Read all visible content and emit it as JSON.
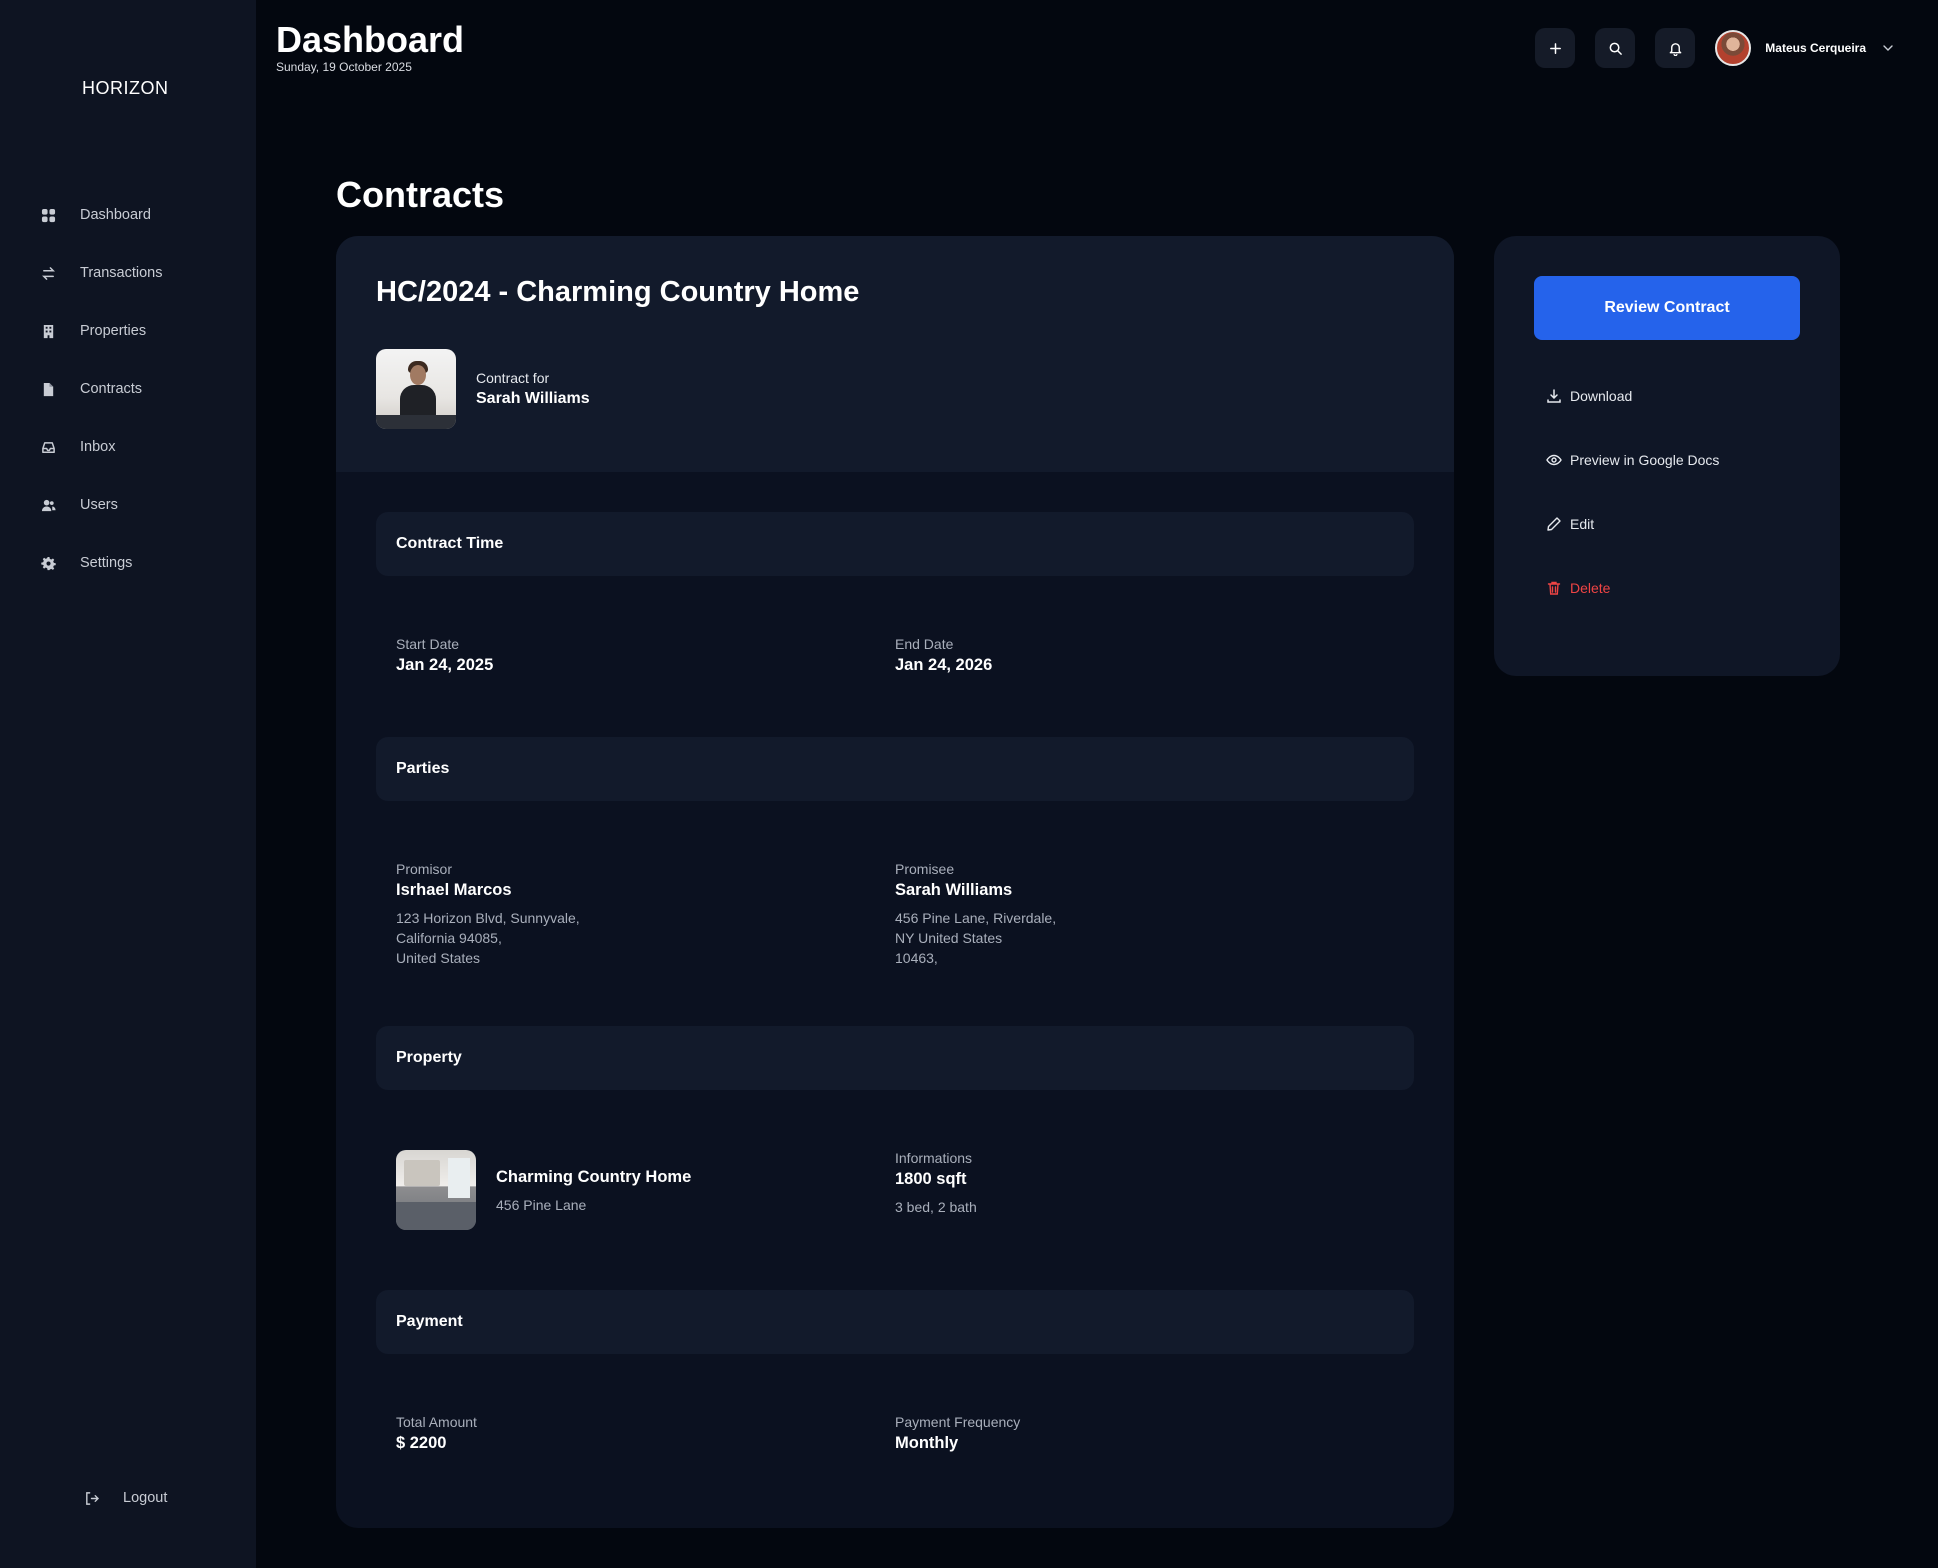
{
  "brand": {
    "logo_text": "HORIZON"
  },
  "header": {
    "title": "Dashboard",
    "date": "Sunday, 19 October 2025",
    "user_name": "Mateus Cerqueira"
  },
  "sidebar": {
    "items": [
      {
        "label": "Dashboard",
        "icon": "grid-icon"
      },
      {
        "label": "Transactions",
        "icon": "arrows-swap-icon"
      },
      {
        "label": "Properties",
        "icon": "building-icon"
      },
      {
        "label": "Contracts",
        "icon": "document-icon"
      },
      {
        "label": "Inbox",
        "icon": "inbox-icon"
      },
      {
        "label": "Users",
        "icon": "users-icon"
      },
      {
        "label": "Settings",
        "icon": "gear-icon"
      }
    ],
    "logout_label": "Logout"
  },
  "page": {
    "title": "Contracts"
  },
  "contract": {
    "title": "HC/2024 - Charming Country Home",
    "for_label": "Contract for",
    "client_name": "Sarah Williams",
    "sections": {
      "time": "Contract Time",
      "parties": "Parties",
      "property": "Property",
      "payment": "Payment"
    },
    "time": {
      "start_label": "Start Date",
      "start_value": "Jan 24, 2025",
      "end_label": "End Date",
      "end_value": "Jan 24, 2026"
    },
    "parties": {
      "promisor_label": "Promisor",
      "promisor_name": "Isrhael Marcos",
      "promisor_address": [
        "123 Horizon Blvd, Sunnyvale,",
        "California 94085,",
        "United States"
      ],
      "promisee_label": "Promisee",
      "promisee_name": "Sarah Williams",
      "promisee_address": [
        "456 Pine Lane, Riverdale,",
        "NY United States",
        "10463,"
      ]
    },
    "property": {
      "name": "Charming Country Home",
      "address": "456 Pine Lane",
      "info_label": "Informations",
      "size": "1800 sqft",
      "rooms": "3 bed, 2 bath"
    },
    "payment": {
      "total_label": "Total Amount",
      "total_value": "$ 2200",
      "freq_label": "Payment Frequency",
      "freq_value": "Monthly"
    }
  },
  "actions": {
    "review": "Review Contract",
    "download": "Download",
    "preview": "Preview in Google Docs",
    "edit": "Edit",
    "delete": "Delete"
  },
  "colors": {
    "accent": "#2563eb",
    "danger": "#ef4444",
    "background": "#03070f",
    "sidebar": "#0e1422",
    "card": "#0b1120"
  }
}
